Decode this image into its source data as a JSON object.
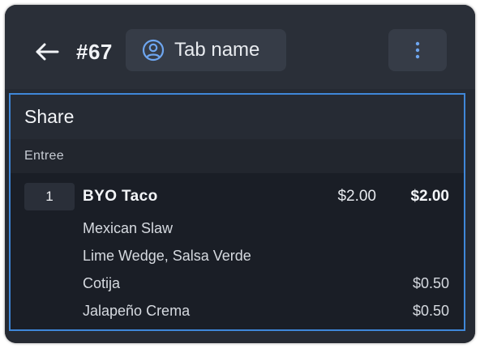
{
  "header": {
    "back_icon": "arrow-left-icon",
    "order_number": "#67",
    "tab_chip": {
      "icon": "user-circle-icon",
      "label": "Tab name"
    },
    "menu_icon": "more-vertical-icon"
  },
  "panel": {
    "title": "Share",
    "section": "Entree",
    "item": {
      "quantity": "1",
      "name": "BYO Taco",
      "unit_price": "$2.00",
      "total": "$2.00",
      "modifiers": [
        {
          "label": "Mexican Slaw",
          "price": ""
        },
        {
          "label": "Lime Wedge, Salsa Verde",
          "price": ""
        },
        {
          "label": "Cotija",
          "price": "$0.50"
        },
        {
          "label": "Jalapeño Crema",
          "price": "$0.50"
        }
      ]
    }
  },
  "colors": {
    "accent_border": "#3f87d9",
    "background": "#1a1e26",
    "header": "#2a2f38"
  }
}
